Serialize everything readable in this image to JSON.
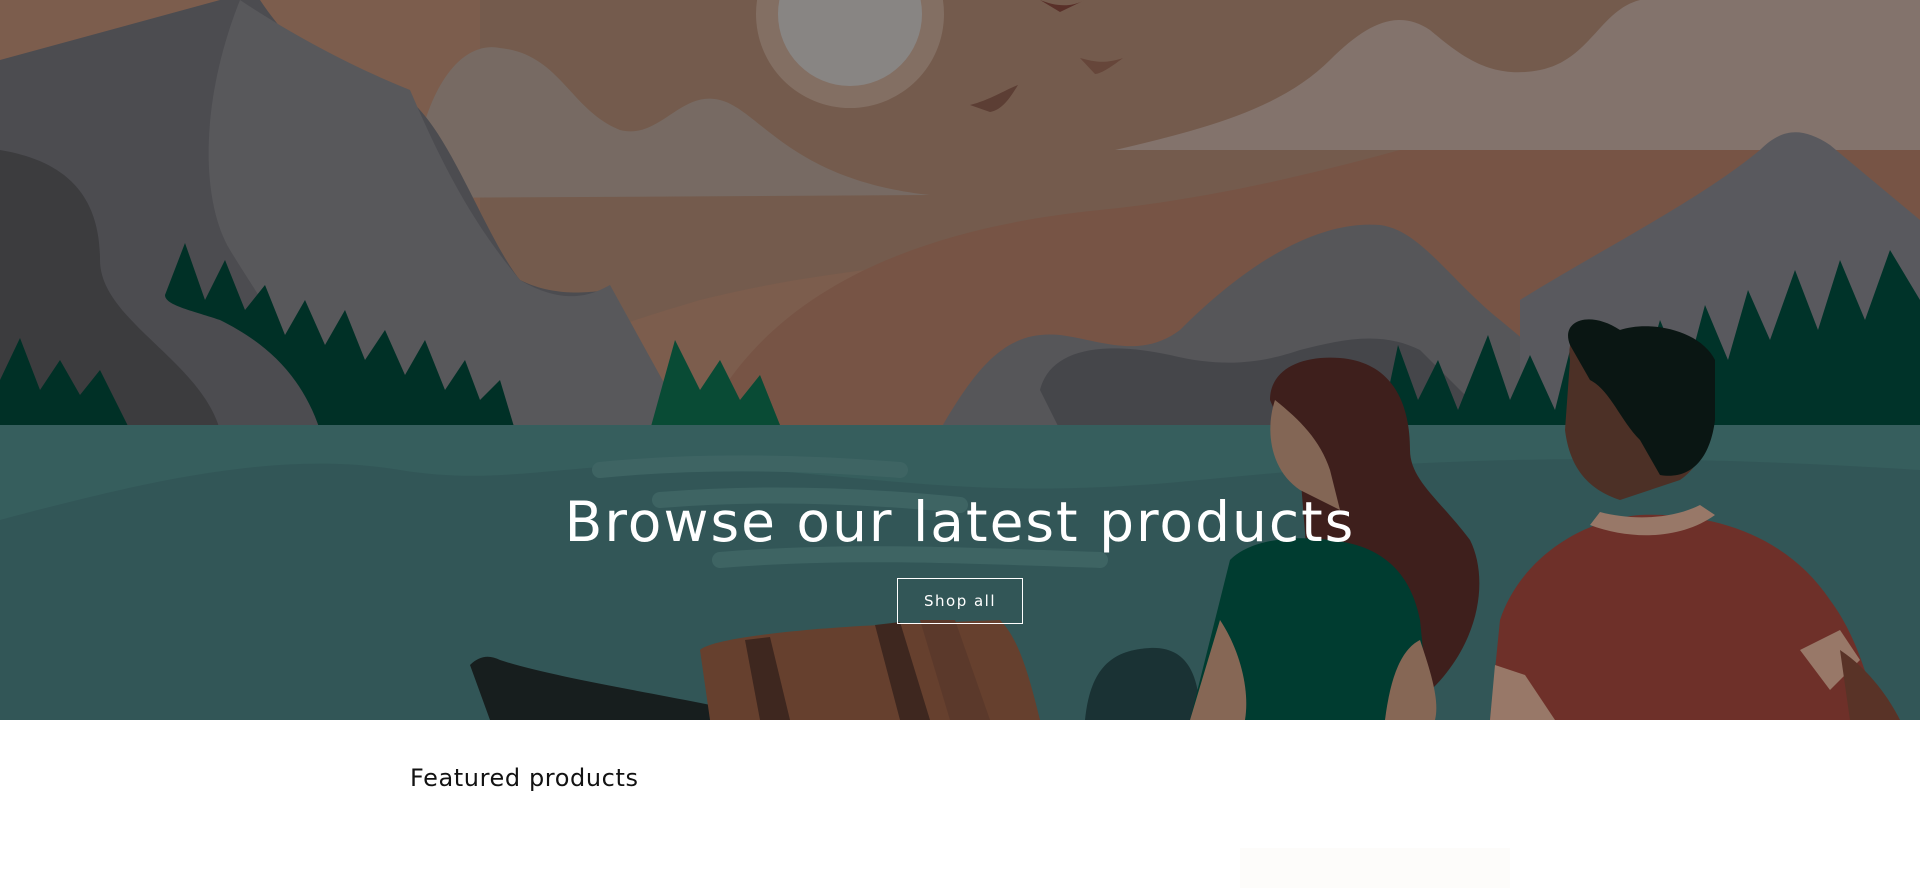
{
  "hero": {
    "title": "Browse our latest products",
    "button_label": "Shop all"
  },
  "featured": {
    "title": "Featured products"
  },
  "icons": {
    "hero_art": "lake-mountains-illustration"
  },
  "colors": {
    "sky": "#8c6e5e",
    "water": "#3f6a6a",
    "mountain": "#525357",
    "forest": "#003d32",
    "text_dark": "#121212"
  }
}
